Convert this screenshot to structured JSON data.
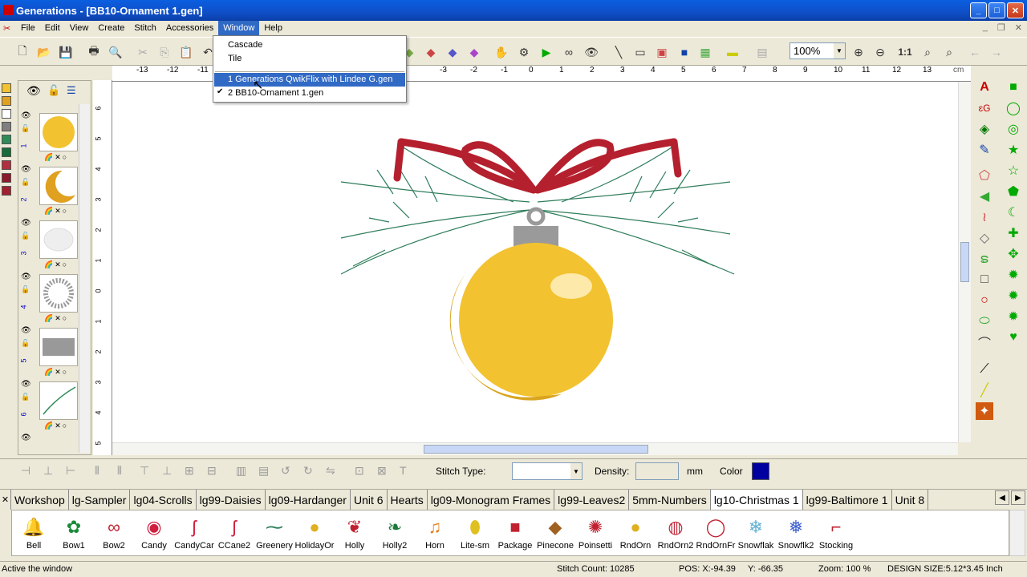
{
  "window": {
    "title": "Generations - [BB10-Ornament 1.gen]",
    "min": "_",
    "max": "□",
    "close": "✕"
  },
  "menu": [
    "File",
    "Edit",
    "View",
    "Create",
    "Stitch",
    "Accessories",
    "Window",
    "Help"
  ],
  "window_menu": {
    "items": [
      "Cascade",
      "Tile",
      "1 Generations QwikFlix with Lindee G.gen",
      "2 BB10-Ornament 1.gen"
    ],
    "checkmark": "✔"
  },
  "zoom": {
    "value": "100%",
    "one_to_one": "1:1"
  },
  "ruler": {
    "unit": "cm",
    "h_ticks": [
      "-13",
      "-12",
      "-11",
      "-3",
      "-2",
      "-1",
      "0",
      "1",
      "2",
      "3",
      "4",
      "5",
      "6",
      "7",
      "8",
      "9",
      "10",
      "11",
      "12",
      "13"
    ],
    "v_ticks": [
      "6",
      "5",
      "4",
      "3",
      "2",
      "1",
      "0",
      "1",
      "2",
      "3",
      "4",
      "5"
    ]
  },
  "layers": [
    {
      "num": "1",
      "shape": "circle-yellow"
    },
    {
      "num": "2",
      "shape": "crescent-yellow"
    },
    {
      "num": "3",
      "shape": "white-sphere"
    },
    {
      "num": "4",
      "shape": "gray-ring"
    },
    {
      "num": "5",
      "shape": "gray-cap"
    },
    {
      "num": "6",
      "shape": "green-branch"
    }
  ],
  "left_colors": [
    "#f2c230",
    "#e0a020",
    "#ffffff",
    "#808080",
    "#2e8b57",
    "#1a6b3a",
    "#b03040",
    "#8b1a2a",
    "#a02030"
  ],
  "properties": {
    "stitch_type_label": "Stitch Type:",
    "density_label": "Density:",
    "density_unit": "mm",
    "color_label": "Color",
    "color_value": "#0000a0"
  },
  "tabs": [
    "Workshop",
    "lg-Sampler",
    "lg04-Scrolls",
    "lg99-Daisies",
    "lg09-Hardanger",
    "Unit 6",
    "Hearts",
    "lg09-Monogram Frames",
    "lg99-Leaves2",
    "5mm-Numbers",
    "lg10-Christmas 1",
    "lg99-Baltimore 1",
    "Unit 8"
  ],
  "active_tab": "lg10-Christmas 1",
  "library": [
    "Bell",
    "Bow1",
    "Bow2",
    "Candy",
    "CandyCar",
    "CCane2",
    "Greenery",
    "HolidayOr",
    "Holly",
    "Holly2",
    "Horn",
    "Lite-sm",
    "Package",
    "Pinecone",
    "Poinsetti",
    "RndOrn",
    "RndOrn2",
    "RndOrnFr",
    "Snowflak",
    "Snowflk2",
    "Stocking"
  ],
  "status": {
    "hint": "Active the window",
    "stitch_count": "Stitch Count:  10285",
    "pos": "POS: X:-94.39     Y: -66.35",
    "zoom": "Zoom:  100 %",
    "design_size": "DESIGN SIZE:5.12*3.45 Inch"
  }
}
